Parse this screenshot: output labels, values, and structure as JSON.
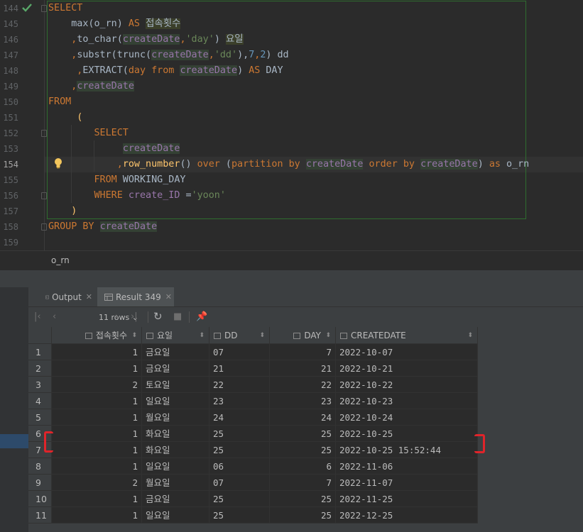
{
  "editor": {
    "line_numbers": [
      "144",
      "145",
      "146",
      "147",
      "148",
      "149",
      "150",
      "151",
      "152",
      "153",
      "154",
      "155",
      "156",
      "157",
      "158",
      "159"
    ],
    "lines": [
      [
        {
          "t": "SELECT",
          "c": "kw"
        }
      ],
      [
        {
          "t": "    max(o_rn) ",
          "c": "plain"
        },
        {
          "t": "AS",
          "c": "kw"
        },
        {
          "t": " ",
          "c": "plain"
        },
        {
          "t": "접속횟수",
          "c": "al"
        }
      ],
      [
        {
          "t": "    ,",
          "c": "kw"
        },
        {
          "t": "to_char(",
          "c": "plain"
        },
        {
          "t": "createDate",
          "c": "id"
        },
        {
          "t": ",",
          "c": "kw"
        },
        {
          "t": "'day'",
          "c": "str"
        },
        {
          "t": ") ",
          "c": "plain"
        },
        {
          "t": "요일",
          "c": "al"
        }
      ],
      [
        {
          "t": "    ,",
          "c": "kw"
        },
        {
          "t": "substr(trunc(",
          "c": "plain"
        },
        {
          "t": "createDate",
          "c": "id"
        },
        {
          "t": ",",
          "c": "kw"
        },
        {
          "t": "'dd'",
          "c": "str"
        },
        {
          "t": "),",
          "c": "plain"
        },
        {
          "t": "7",
          "c": "num"
        },
        {
          "t": ",",
          "c": "kw"
        },
        {
          "t": "2",
          "c": "num"
        },
        {
          "t": ") dd",
          "c": "plain"
        }
      ],
      [
        {
          "t": "     ,",
          "c": "kw"
        },
        {
          "t": "EXTRACT(",
          "c": "plain"
        },
        {
          "t": "day",
          "c": "kw"
        },
        {
          "t": " ",
          "c": "plain"
        },
        {
          "t": "from",
          "c": "kw"
        },
        {
          "t": " ",
          "c": "plain"
        },
        {
          "t": "createDate",
          "c": "id"
        },
        {
          "t": ") ",
          "c": "plain"
        },
        {
          "t": "AS",
          "c": "kw"
        },
        {
          "t": " DAY",
          "c": "plain"
        }
      ],
      [
        {
          "t": "    ,",
          "c": "kw"
        },
        {
          "t": "createDate",
          "c": "id"
        }
      ],
      [
        {
          "t": "FROM",
          "c": "kw"
        }
      ],
      [
        {
          "t": "     (",
          "c": "fn"
        }
      ],
      [
        {
          "t": "        SELECT",
          "c": "kw"
        }
      ],
      [
        {
          "t": "             ",
          "c": "plain"
        },
        {
          "t": "createDate",
          "c": "id"
        }
      ],
      [
        {
          "t": "            ,",
          "c": "kw"
        },
        {
          "t": "row_number",
          "c": "fn"
        },
        {
          "t": "() ",
          "c": "plain"
        },
        {
          "t": "over",
          "c": "kw"
        },
        {
          "t": " (",
          "c": "plain"
        },
        {
          "t": "partition",
          "c": "kw"
        },
        {
          "t": " ",
          "c": "plain"
        },
        {
          "t": "by",
          "c": "kw"
        },
        {
          "t": " ",
          "c": "plain"
        },
        {
          "t": "createDate",
          "c": "id"
        },
        {
          "t": " ",
          "c": "plain"
        },
        {
          "t": "order",
          "c": "kw"
        },
        {
          "t": " ",
          "c": "plain"
        },
        {
          "t": "by",
          "c": "kw"
        },
        {
          "t": " ",
          "c": "plain"
        },
        {
          "t": "createDate",
          "c": "id"
        },
        {
          "t": ") ",
          "c": "plain"
        },
        {
          "t": "as",
          "c": "kw"
        },
        {
          "t": " o_rn",
          "c": "plain"
        }
      ],
      [
        {
          "t": "        FROM",
          "c": "kw"
        },
        {
          "t": " WORKING_DAY",
          "c": "plain"
        }
      ],
      [
        {
          "t": "        WHERE",
          "c": "kw"
        },
        {
          "t": " ",
          "c": "plain"
        },
        {
          "t": "create_ID",
          "c": "id2"
        },
        {
          "t": " =",
          "c": "plain"
        },
        {
          "t": "'yoon'",
          "c": "str"
        }
      ],
      [
        {
          "t": "    )",
          "c": "fn"
        }
      ],
      [
        {
          "t": "GROUP BY",
          "c": "kw"
        },
        {
          "t": " ",
          "c": "plain"
        },
        {
          "t": "createDate",
          "c": "id"
        }
      ],
      []
    ]
  },
  "breadcrumb": "o_rn",
  "tabs": [
    {
      "label": "Output",
      "icon": "output-icon"
    },
    {
      "label": "Result 349",
      "icon": "table-icon"
    }
  ],
  "toolbar": {
    "rows_label": "11 rows"
  },
  "grid": {
    "columns": [
      "접속횟수",
      "요일",
      "DD",
      "DAY",
      "CREATEDATE"
    ],
    "rows": [
      [
        "1",
        "1",
        "금요일",
        "07",
        "7",
        "2022-10-07"
      ],
      [
        "2",
        "1",
        "금요일",
        "21",
        "21",
        "2022-10-21"
      ],
      [
        "3",
        "2",
        "토요일",
        "22",
        "22",
        "2022-10-22"
      ],
      [
        "4",
        "1",
        "일요일",
        "23",
        "23",
        "2022-10-23"
      ],
      [
        "5",
        "1",
        "월요일",
        "24",
        "24",
        "2022-10-24"
      ],
      [
        "6",
        "1",
        "화요일",
        "25",
        "25",
        "2022-10-25"
      ],
      [
        "7",
        "1",
        "화요일",
        "25",
        "25",
        "2022-10-25 15:52:44"
      ],
      [
        "8",
        "1",
        "일요일",
        "06",
        "6",
        "2022-11-06"
      ],
      [
        "9",
        "2",
        "월요일",
        "07",
        "7",
        "2022-11-07"
      ],
      [
        "10",
        "1",
        "금요일",
        "25",
        "25",
        "2022-11-25"
      ],
      [
        "11",
        "1",
        "일요일",
        "25",
        "25",
        "2022-12-25"
      ]
    ]
  },
  "colors": {
    "highlight": "#e0242a",
    "keyword": "#cc7832",
    "string": "#6a8759"
  }
}
